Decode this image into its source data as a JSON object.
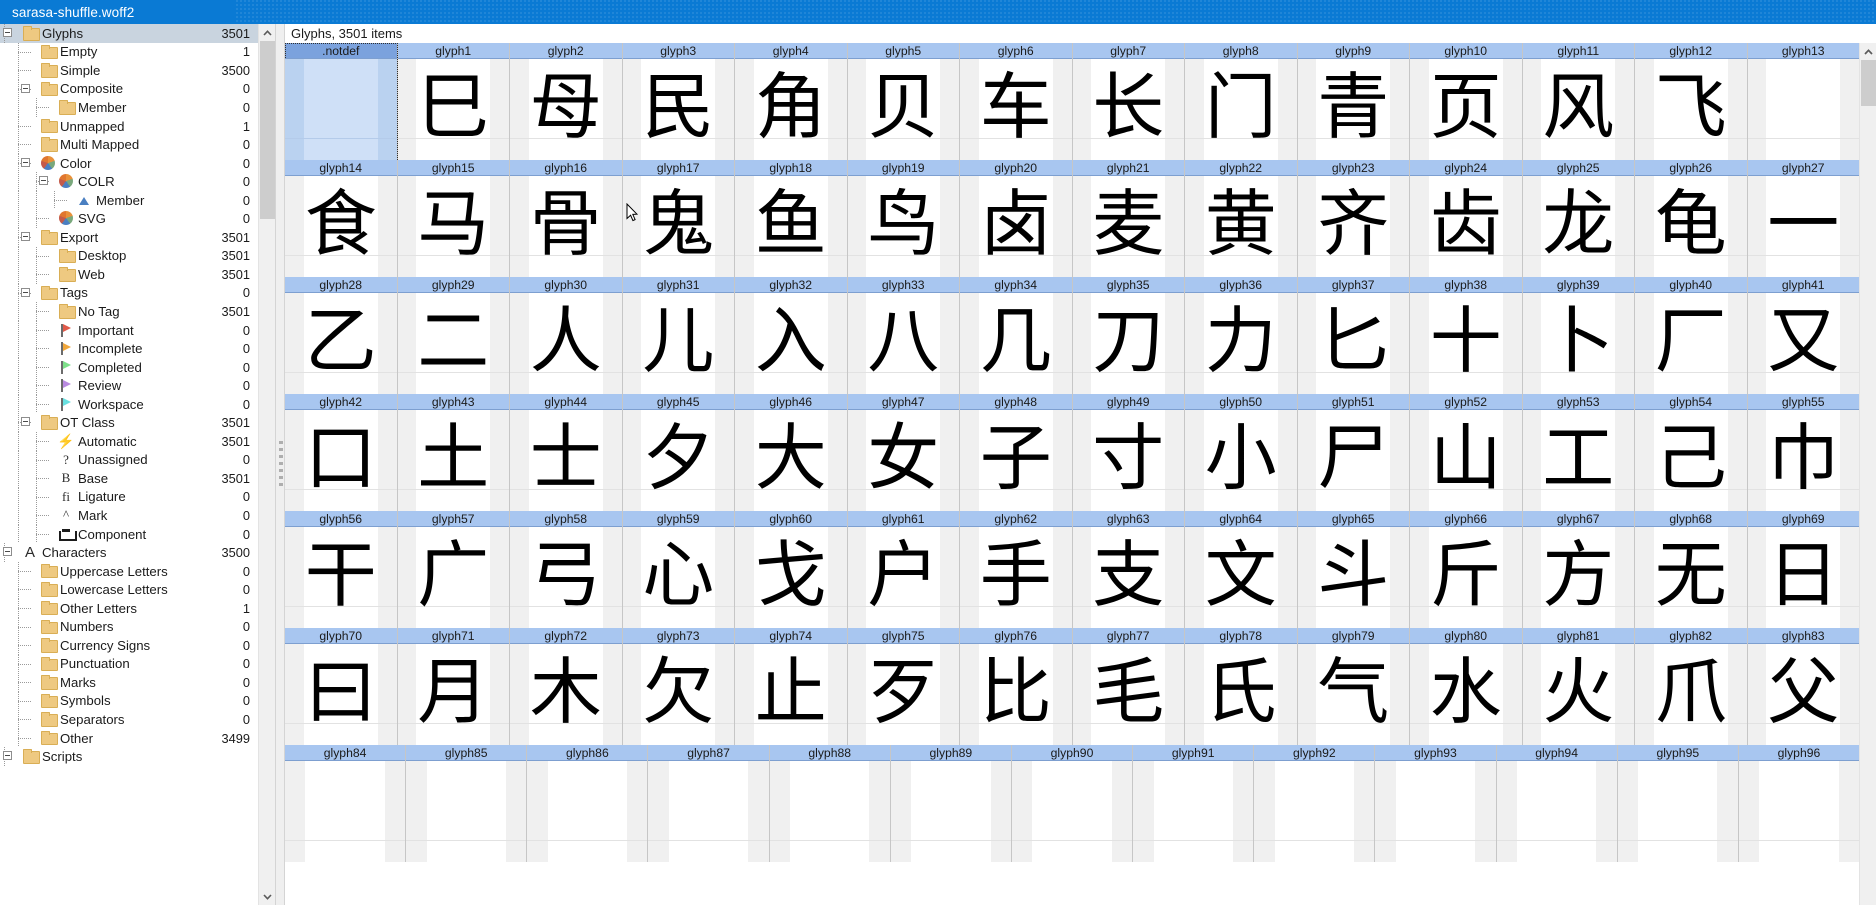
{
  "window": {
    "title": "sarasa-shuffle.woff2",
    "titlebar_color": "#0a7ad4"
  },
  "sidebar": {
    "scroll_up_icon": "chevron-up-icon",
    "scroll_down_icon": "chevron-down-icon",
    "items": [
      {
        "label": "Glyphs",
        "count": "3501",
        "depth": 0,
        "icon": "folder",
        "expander": "minus",
        "selected": true
      },
      {
        "label": "Empty",
        "count": "1",
        "depth": 1,
        "icon": "folder",
        "expander": "none",
        "selected": false
      },
      {
        "label": "Simple",
        "count": "3500",
        "depth": 1,
        "icon": "folder",
        "expander": "none",
        "selected": false
      },
      {
        "label": "Composite",
        "count": "0",
        "depth": 1,
        "icon": "folder",
        "expander": "minus",
        "selected": false
      },
      {
        "label": "Member",
        "count": "0",
        "depth": 2,
        "icon": "folder",
        "expander": "none",
        "selected": false
      },
      {
        "label": "Unmapped",
        "count": "1",
        "depth": 1,
        "icon": "folder",
        "expander": "none",
        "selected": false
      },
      {
        "label": "Multi Mapped",
        "count": "0",
        "depth": 1,
        "icon": "folder",
        "expander": "none",
        "selected": false
      },
      {
        "label": "Color",
        "count": "0",
        "depth": 1,
        "icon": "pie",
        "expander": "minus",
        "selected": false
      },
      {
        "label": "COLR",
        "count": "0",
        "depth": 2,
        "icon": "pie",
        "expander": "minus",
        "selected": false
      },
      {
        "label": "Member",
        "count": "0",
        "depth": 3,
        "icon": "tri",
        "expander": "none",
        "selected": false
      },
      {
        "label": "SVG",
        "count": "0",
        "depth": 2,
        "icon": "pie",
        "expander": "none",
        "selected": false
      },
      {
        "label": "Export",
        "count": "3501",
        "depth": 1,
        "icon": "folder",
        "expander": "minus",
        "selected": false
      },
      {
        "label": "Desktop",
        "count": "3501",
        "depth": 2,
        "icon": "folder",
        "expander": "none",
        "selected": false
      },
      {
        "label": "Web",
        "count": "3501",
        "depth": 2,
        "icon": "folder",
        "expander": "none",
        "selected": false
      },
      {
        "label": "Tags",
        "count": "0",
        "depth": 1,
        "icon": "folder",
        "expander": "minus",
        "selected": false
      },
      {
        "label": "No Tag",
        "count": "3501",
        "depth": 2,
        "icon": "folder",
        "expander": "none",
        "selected": false
      },
      {
        "label": "Important",
        "count": "0",
        "depth": 2,
        "icon": "flag",
        "flag_color": "#e05a4a",
        "expander": "none",
        "selected": false
      },
      {
        "label": "Incomplete",
        "count": "0",
        "depth": 2,
        "icon": "flag",
        "flag_color": "#f0a73c",
        "expander": "none",
        "selected": false
      },
      {
        "label": "Completed",
        "count": "0",
        "depth": 2,
        "icon": "flag",
        "flag_color": "#7ee08a",
        "expander": "none",
        "selected": false
      },
      {
        "label": "Review",
        "count": "0",
        "depth": 2,
        "icon": "flag",
        "flag_color": "#b98ae0",
        "expander": "none",
        "selected": false
      },
      {
        "label": "Workspace",
        "count": "0",
        "depth": 2,
        "icon": "flag",
        "flag_color": "#68e0e0",
        "expander": "none",
        "selected": false
      },
      {
        "label": "OT Class",
        "count": "3501",
        "depth": 1,
        "icon": "folder",
        "expander": "minus",
        "selected": false
      },
      {
        "label": "Automatic",
        "count": "3501",
        "depth": 2,
        "icon": "bolt",
        "glyph": "⚡",
        "expander": "none",
        "selected": false
      },
      {
        "label": "Unassigned",
        "count": "0",
        "depth": 2,
        "icon": "gtext",
        "glyph": "?",
        "expander": "none",
        "selected": false
      },
      {
        "label": "Base",
        "count": "3501",
        "depth": 2,
        "icon": "gtext",
        "glyph": "B",
        "expander": "none",
        "selected": false
      },
      {
        "label": "Ligature",
        "count": "0",
        "depth": 2,
        "icon": "gtext",
        "glyph": "fi",
        "expander": "none",
        "selected": false
      },
      {
        "label": "Mark",
        "count": "0",
        "depth": 2,
        "icon": "gtext",
        "glyph": "^",
        "expander": "none",
        "selected": false
      },
      {
        "label": "Component",
        "count": "0",
        "depth": 2,
        "icon": "comp",
        "expander": "none",
        "selected": false
      },
      {
        "label": "Characters",
        "count": "3500",
        "depth": 0,
        "icon": "bigA",
        "glyph": "A",
        "expander": "minus",
        "selected": false
      },
      {
        "label": "Uppercase Letters",
        "count": "0",
        "depth": 1,
        "icon": "folder",
        "expander": "none",
        "selected": false
      },
      {
        "label": "Lowercase Letters",
        "count": "0",
        "depth": 1,
        "icon": "folder",
        "expander": "none",
        "selected": false
      },
      {
        "label": "Other Letters",
        "count": "1",
        "depth": 1,
        "icon": "folder",
        "expander": "none",
        "selected": false
      },
      {
        "label": "Numbers",
        "count": "0",
        "depth": 1,
        "icon": "folder",
        "expander": "none",
        "selected": false
      },
      {
        "label": "Currency Signs",
        "count": "0",
        "depth": 1,
        "icon": "folder",
        "expander": "none",
        "selected": false
      },
      {
        "label": "Punctuation",
        "count": "0",
        "depth": 1,
        "icon": "folder",
        "expander": "none",
        "selected": false
      },
      {
        "label": "Marks",
        "count": "0",
        "depth": 1,
        "icon": "folder",
        "expander": "none",
        "selected": false
      },
      {
        "label": "Symbols",
        "count": "0",
        "depth": 1,
        "icon": "folder",
        "expander": "none",
        "selected": false
      },
      {
        "label": "Separators",
        "count": "0",
        "depth": 1,
        "icon": "folder",
        "expander": "none",
        "selected": false
      },
      {
        "label": "Other",
        "count": "3499",
        "depth": 1,
        "icon": "folder",
        "expander": "none",
        "selected": false
      },
      {
        "label": "Scripts",
        "count": "",
        "depth": 0,
        "icon": "folder",
        "expander": "minus",
        "selected": false
      }
    ]
  },
  "glyph_panel": {
    "header": "Glyphs, 3501 items",
    "scroll_up_icon": "chevron-up-icon",
    "rows": [
      {
        "cells": [
          {
            "name": ".notdef",
            "char": "",
            "selected": true
          },
          {
            "name": "glyph1",
            "char": "巳",
            "selected": false
          },
          {
            "name": "glyph2",
            "char": "母",
            "selected": false
          },
          {
            "name": "glyph3",
            "char": "民",
            "selected": false
          },
          {
            "name": "glyph4",
            "char": "角",
            "selected": false
          },
          {
            "name": "glyph5",
            "char": "贝",
            "selected": false
          },
          {
            "name": "glyph6",
            "char": "车",
            "selected": false
          },
          {
            "name": "glyph7",
            "char": "长",
            "selected": false
          },
          {
            "name": "glyph8",
            "char": "门",
            "selected": false
          },
          {
            "name": "glyph9",
            "char": "青",
            "selected": false
          },
          {
            "name": "glyph10",
            "char": "页",
            "selected": false
          },
          {
            "name": "glyph11",
            "char": "风",
            "selected": false
          },
          {
            "name": "glyph12",
            "char": "飞",
            "selected": false
          },
          {
            "name": "glyph13",
            "char": "",
            "selected": false
          }
        ]
      },
      {
        "cells": [
          {
            "name": "glyph14",
            "char": "食",
            "selected": false
          },
          {
            "name": "glyph15",
            "char": "马",
            "selected": false
          },
          {
            "name": "glyph16",
            "char": "骨",
            "selected": false
          },
          {
            "name": "glyph17",
            "char": "鬼",
            "selected": false
          },
          {
            "name": "glyph18",
            "char": "鱼",
            "selected": false
          },
          {
            "name": "glyph19",
            "char": "鸟",
            "selected": false
          },
          {
            "name": "glyph20",
            "char": "卤",
            "selected": false
          },
          {
            "name": "glyph21",
            "char": "麦",
            "selected": false
          },
          {
            "name": "glyph22",
            "char": "黄",
            "selected": false
          },
          {
            "name": "glyph23",
            "char": "齐",
            "selected": false
          },
          {
            "name": "glyph24",
            "char": "齿",
            "selected": false
          },
          {
            "name": "glyph25",
            "char": "龙",
            "selected": false
          },
          {
            "name": "glyph26",
            "char": "龟",
            "selected": false
          },
          {
            "name": "glyph27",
            "char": "一",
            "selected": false
          }
        ]
      },
      {
        "cells": [
          {
            "name": "glyph28",
            "char": "乙",
            "selected": false
          },
          {
            "name": "glyph29",
            "char": "二",
            "selected": false
          },
          {
            "name": "glyph30",
            "char": "人",
            "selected": false
          },
          {
            "name": "glyph31",
            "char": "儿",
            "selected": false
          },
          {
            "name": "glyph32",
            "char": "入",
            "selected": false
          },
          {
            "name": "glyph33",
            "char": "八",
            "selected": false
          },
          {
            "name": "glyph34",
            "char": "几",
            "selected": false
          },
          {
            "name": "glyph35",
            "char": "刀",
            "selected": false
          },
          {
            "name": "glyph36",
            "char": "力",
            "selected": false
          },
          {
            "name": "glyph37",
            "char": "匕",
            "selected": false
          },
          {
            "name": "glyph38",
            "char": "十",
            "selected": false
          },
          {
            "name": "glyph39",
            "char": "卜",
            "selected": false
          },
          {
            "name": "glyph40",
            "char": "厂",
            "selected": false
          },
          {
            "name": "glyph41",
            "char": "又",
            "selected": false
          }
        ]
      },
      {
        "cells": [
          {
            "name": "glyph42",
            "char": "口",
            "selected": false
          },
          {
            "name": "glyph43",
            "char": "土",
            "selected": false
          },
          {
            "name": "glyph44",
            "char": "士",
            "selected": false
          },
          {
            "name": "glyph45",
            "char": "夕",
            "selected": false
          },
          {
            "name": "glyph46",
            "char": "大",
            "selected": false
          },
          {
            "name": "glyph47",
            "char": "女",
            "selected": false
          },
          {
            "name": "glyph48",
            "char": "子",
            "selected": false
          },
          {
            "name": "glyph49",
            "char": "寸",
            "selected": false
          },
          {
            "name": "glyph50",
            "char": "小",
            "selected": false
          },
          {
            "name": "glyph51",
            "char": "尸",
            "selected": false
          },
          {
            "name": "glyph52",
            "char": "山",
            "selected": false
          },
          {
            "name": "glyph53",
            "char": "工",
            "selected": false
          },
          {
            "name": "glyph54",
            "char": "己",
            "selected": false
          },
          {
            "name": "glyph55",
            "char": "巾",
            "selected": false
          }
        ]
      },
      {
        "cells": [
          {
            "name": "glyph56",
            "char": "干",
            "selected": false
          },
          {
            "name": "glyph57",
            "char": "广",
            "selected": false
          },
          {
            "name": "glyph58",
            "char": "弓",
            "selected": false
          },
          {
            "name": "glyph59",
            "char": "心",
            "selected": false
          },
          {
            "name": "glyph60",
            "char": "戈",
            "selected": false
          },
          {
            "name": "glyph61",
            "char": "户",
            "selected": false
          },
          {
            "name": "glyph62",
            "char": "手",
            "selected": false
          },
          {
            "name": "glyph63",
            "char": "支",
            "selected": false
          },
          {
            "name": "glyph64",
            "char": "文",
            "selected": false
          },
          {
            "name": "glyph65",
            "char": "斗",
            "selected": false
          },
          {
            "name": "glyph66",
            "char": "斤",
            "selected": false
          },
          {
            "name": "glyph67",
            "char": "方",
            "selected": false
          },
          {
            "name": "glyph68",
            "char": "无",
            "selected": false
          },
          {
            "name": "glyph69",
            "char": "日",
            "selected": false
          }
        ]
      },
      {
        "cells": [
          {
            "name": "glyph70",
            "char": "曰",
            "selected": false
          },
          {
            "name": "glyph71",
            "char": "月",
            "selected": false
          },
          {
            "name": "glyph72",
            "char": "木",
            "selected": false
          },
          {
            "name": "glyph73",
            "char": "欠",
            "selected": false
          },
          {
            "name": "glyph74",
            "char": "止",
            "selected": false
          },
          {
            "name": "glyph75",
            "char": "歹",
            "selected": false
          },
          {
            "name": "glyph76",
            "char": "比",
            "selected": false
          },
          {
            "name": "glyph77",
            "char": "毛",
            "selected": false
          },
          {
            "name": "glyph78",
            "char": "氏",
            "selected": false
          },
          {
            "name": "glyph79",
            "char": "气",
            "selected": false
          },
          {
            "name": "glyph80",
            "char": "水",
            "selected": false
          },
          {
            "name": "glyph81",
            "char": "火",
            "selected": false
          },
          {
            "name": "glyph82",
            "char": "爪",
            "selected": false
          },
          {
            "name": "glyph83",
            "char": "父",
            "selected": false
          }
        ]
      },
      {
        "cells": [
          {
            "name": "glyph84",
            "char": "",
            "selected": false
          },
          {
            "name": "glyph85",
            "char": "",
            "selected": false
          },
          {
            "name": "glyph86",
            "char": "",
            "selected": false
          },
          {
            "name": "glyph87",
            "char": "",
            "selected": false
          },
          {
            "name": "glyph88",
            "char": "",
            "selected": false
          },
          {
            "name": "glyph89",
            "char": "",
            "selected": false
          },
          {
            "name": "glyph90",
            "char": "",
            "selected": false
          },
          {
            "name": "glyph91",
            "char": "",
            "selected": false
          },
          {
            "name": "glyph92",
            "char": "",
            "selected": false
          },
          {
            "name": "glyph93",
            "char": "",
            "selected": false
          },
          {
            "name": "glyph94",
            "char": "",
            "selected": false
          },
          {
            "name": "glyph95",
            "char": "",
            "selected": false
          },
          {
            "name": "glyph96",
            "char": "",
            "selected": false
          }
        ]
      }
    ]
  }
}
